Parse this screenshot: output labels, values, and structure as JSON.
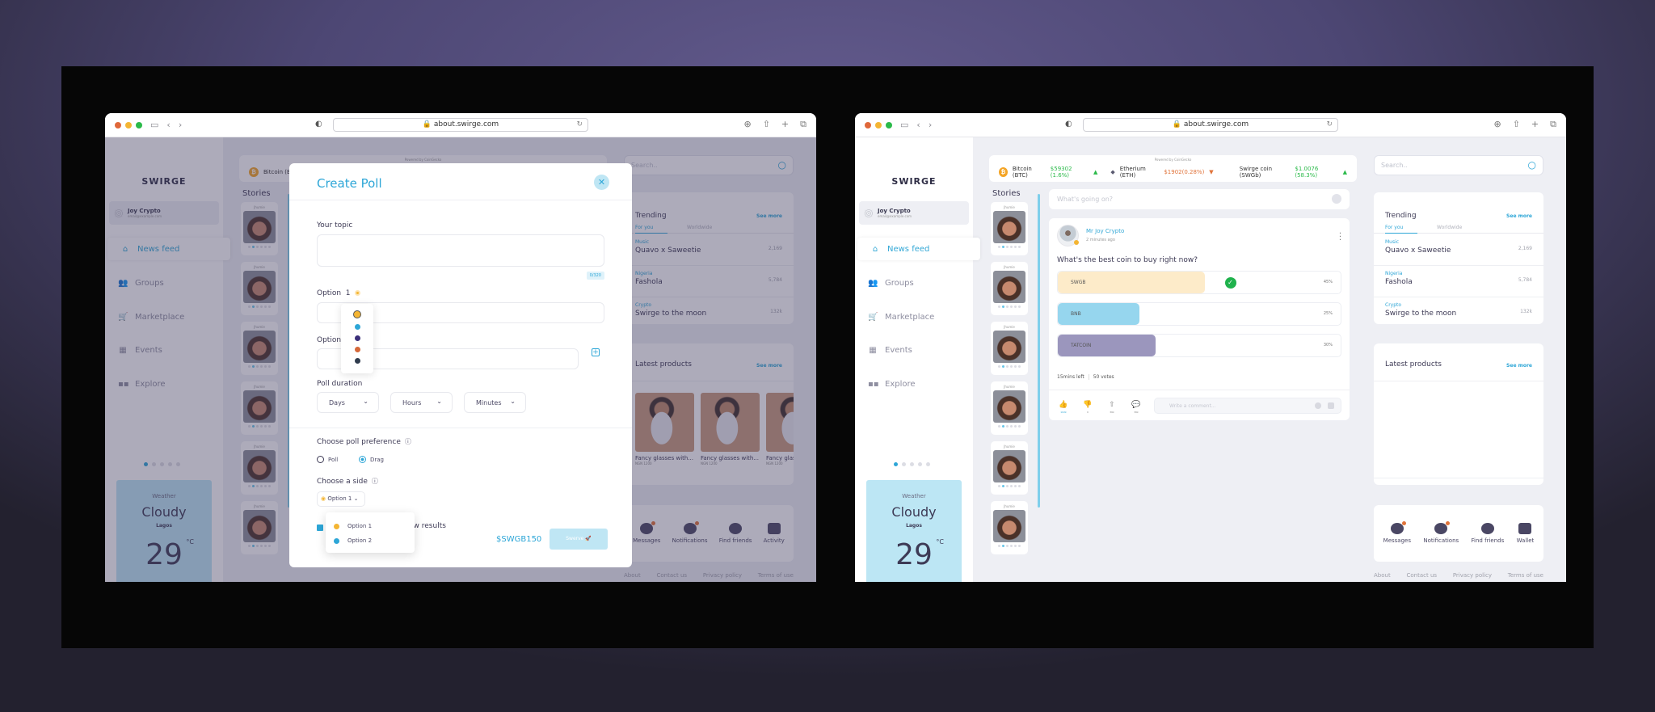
{
  "browser": {
    "url": "about.swirge.com",
    "traffic_lights": [
      "#e0683a",
      "#f4b533",
      "#2bba4a"
    ]
  },
  "app": {
    "logo": "SWIRGE",
    "user": {
      "name": "Joy Crypto",
      "email": "email@example.com"
    },
    "nav": [
      {
        "label": "News feed",
        "icon": "home-icon",
        "active": true
      },
      {
        "label": "Groups",
        "icon": "groups-icon"
      },
      {
        "label": "Marketplace",
        "icon": "cart-icon"
      },
      {
        "label": "Events",
        "icon": "calendar-icon"
      },
      {
        "label": "Explore",
        "icon": "grid-icon"
      }
    ],
    "weather": {
      "label": "Weather",
      "condition": "Cloudy",
      "city": "Lagos",
      "temp": "29",
      "unit": "°C"
    },
    "ticker": {
      "powered": "Powered by CoinGecko",
      "items": [
        {
          "name": "Bitcoin (BTC)",
          "value": "$59302 (1.6%)",
          "trend": "up"
        },
        {
          "name": "Etherium (ETH)",
          "value": "$1902(0.28%)",
          "trend": "down"
        },
        {
          "name": "Swirge coin (SWGb)",
          "value": "$1.0076 (58.3%)",
          "trend": "up"
        }
      ]
    },
    "stories": {
      "title": "Stories",
      "name": "Jhumie"
    },
    "search_placeholder": "Search..",
    "trending": {
      "title": "Trending",
      "see_more": "See more",
      "tabs": [
        "For you",
        "Worldwide"
      ],
      "items": [
        {
          "category": "Music",
          "title": "Quavo x Saweetie",
          "count": "2,169"
        },
        {
          "category": "Nigeria",
          "title": "Fashola",
          "count": "5,784"
        },
        {
          "category": "Crypto",
          "title": "Swirge to the moon",
          "count": "132k"
        }
      ]
    },
    "products": {
      "title": "Latest products",
      "see_more": "See more",
      "items": [
        {
          "name": "Fancy glasses with...",
          "price": "NGN 1200"
        },
        {
          "name": "Fancy glasses with...",
          "price": "NGN 1200"
        },
        {
          "name": "Fancy glas",
          "price": "NGN 1200"
        }
      ]
    },
    "actions_left": [
      "Messages",
      "Notifications",
      "Find friends",
      "Activity"
    ],
    "actions_right": [
      "Messages",
      "Notifications",
      "Find friends",
      "Wallet"
    ],
    "footer": [
      "About",
      "Contact us",
      "Privacy policy",
      "Terms of use"
    ]
  },
  "modal": {
    "title": "Create Poll",
    "topic_label": "Your topic",
    "counter": "0/320",
    "option1_label": "Option",
    "option1_num": "1",
    "option2_label": "Option",
    "colors": [
      "#f4b533",
      "#2da6d7",
      "#3b2f7a",
      "#d5683a",
      "#2f3b4d"
    ],
    "duration_label": "Poll duration",
    "duration": [
      "Days",
      "Hours",
      "Minutes"
    ],
    "pref_label": "Choose poll preference",
    "pref_options": [
      "Poll",
      "Drag"
    ],
    "pref_selected": "Drag",
    "side_label": "Choose a side",
    "side_value": "Option 1",
    "side_options": [
      "Option 1",
      "Option 2"
    ],
    "view_results": "ew results",
    "price": "$SWGB150",
    "submit": "Swerve 🚀"
  },
  "feed": {
    "compose_placeholder": "What's going on?",
    "post": {
      "author": "Mr Joy Crypto",
      "time": "2 minutes ago",
      "question": "What's the best coin to buy right now?",
      "options": [
        {
          "label": "SWGB",
          "percent": 45,
          "color": "#fdebc9",
          "voted": true
        },
        {
          "label": "BNB",
          "percent": 25,
          "color": "#96d6ee"
        },
        {
          "label": "TATCOIN",
          "percent": 30,
          "color": "#9b96bd"
        }
      ],
      "time_left": "15mins left",
      "votes": "50 votes",
      "reactions": [
        {
          "name": "like",
          "count": "102k"
        },
        {
          "name": "dislike",
          "count": "0"
        },
        {
          "name": "share",
          "count": "36k"
        },
        {
          "name": "comment",
          "count": "36k"
        }
      ],
      "comment_placeholder": "Write a comment..."
    }
  }
}
